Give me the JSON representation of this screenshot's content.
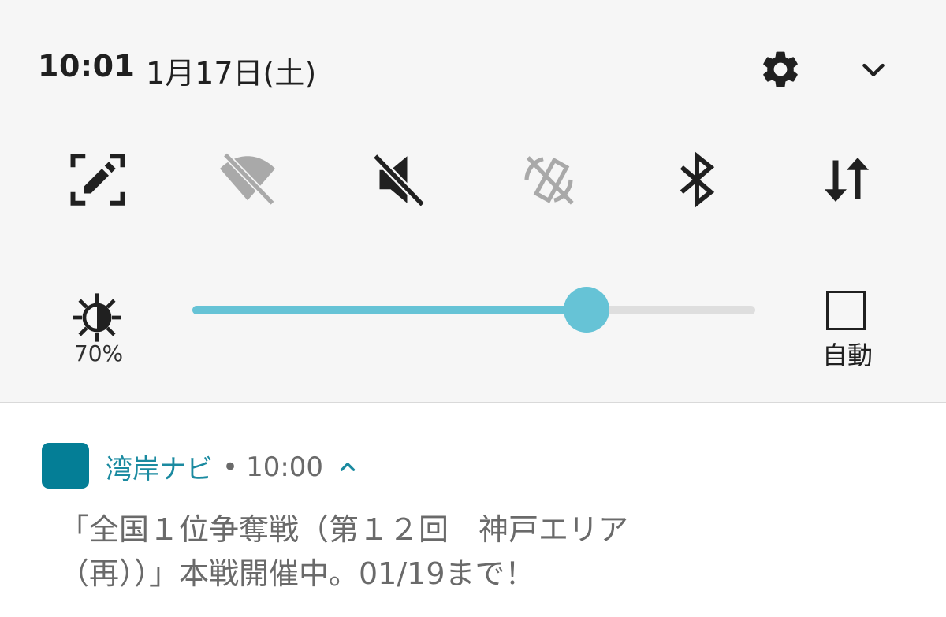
{
  "status_header": {
    "time": "10:01",
    "date": "1月17日(土)"
  },
  "header_buttons": {
    "settings_icon": "gear-icon",
    "collapse_icon": "chevron-down-icon"
  },
  "quick_tiles": [
    {
      "name": "screen-capture",
      "icon": "screen-edit-icon",
      "state": "on"
    },
    {
      "name": "wifi",
      "icon": "wifi-off-icon",
      "state": "disabled"
    },
    {
      "name": "sound",
      "icon": "volume-off-icon",
      "state": "on"
    },
    {
      "name": "auto-rotate",
      "icon": "rotation-lock-icon",
      "state": "disabled"
    },
    {
      "name": "bluetooth",
      "icon": "bluetooth-icon",
      "state": "on"
    },
    {
      "name": "mobile-data",
      "icon": "data-transfer-icon",
      "state": "on"
    }
  ],
  "brightness": {
    "value_label": "70%",
    "level": 0.7,
    "auto_label": "自動",
    "auto_checked": false
  },
  "colors": {
    "panel_bg": "#f6f6f6",
    "accent": "#66c3d6",
    "app_icon": "#047e96",
    "app_name": "#1a8aa0",
    "disabled_icon": "#a9a9a9"
  },
  "notification": {
    "app_name": "湾岸ナビ",
    "separator": "•",
    "time": "10:00",
    "expand_icon": "chevron-up-icon",
    "body_line1": "「全国１位争奪戦（第１２回　神戸エリア",
    "body_line2": "（再））」本戦開催中。01/19まで！"
  }
}
